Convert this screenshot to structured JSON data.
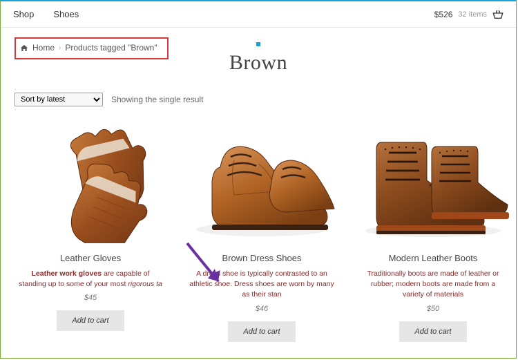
{
  "nav": {
    "shop": "Shop",
    "shoes": "Shoes"
  },
  "cart": {
    "total": "$526",
    "count": "32 items"
  },
  "breadcrumb": {
    "home": "Home",
    "trail": "Products tagged \"Brown\""
  },
  "page_title": "Brown",
  "toolbar": {
    "sort_label": "Sort by latest",
    "result_text": "Showing the single result"
  },
  "products": [
    {
      "title": "Leather Gloves",
      "desc_html": "<b>Leather work gloves</b> are capable of standing up to some of your most <i>rigorous ta</i>",
      "price": "$45",
      "btn": "Add to cart"
    },
    {
      "title": "Brown Dress Shoes",
      "desc_html": "A dress shoe is typically contrasted to an athletic shoe. Dress shoes are worn by many as their stan",
      "price": "$46",
      "btn": "Add to cart"
    },
    {
      "title": "Modern Leather Boots",
      "desc_html": "Traditionally boots are made of leather or rubber; modern boots are made from a variety of materials",
      "price": "$50",
      "btn": "Add to cart"
    }
  ]
}
